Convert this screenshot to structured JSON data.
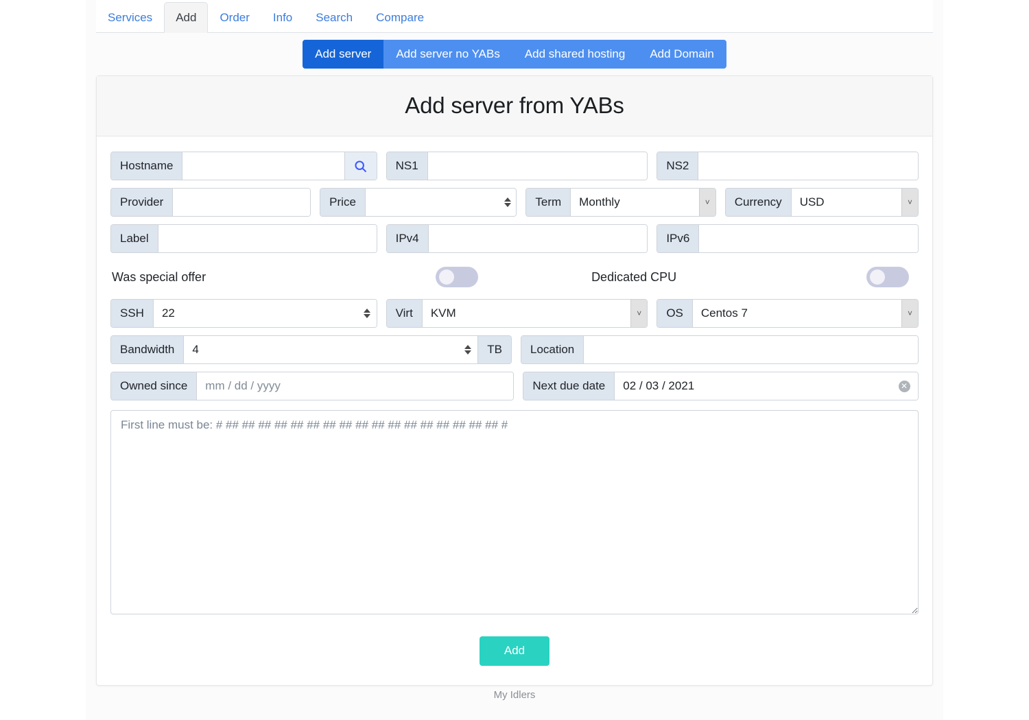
{
  "nav": {
    "tabs": [
      {
        "label": "Services",
        "active": false
      },
      {
        "label": "Add",
        "active": true
      },
      {
        "label": "Order",
        "active": false
      },
      {
        "label": "Info",
        "active": false
      },
      {
        "label": "Search",
        "active": false
      },
      {
        "label": "Compare",
        "active": false
      }
    ]
  },
  "segmented": {
    "buttons": [
      {
        "label": "Add server",
        "active": true
      },
      {
        "label": "Add server no YABs",
        "active": false
      },
      {
        "label": "Add shared hosting",
        "active": false
      },
      {
        "label": "Add Domain",
        "active": false
      }
    ],
    "active_color": "#1565d8",
    "inactive_color": "#4d8ff0"
  },
  "card": {
    "title": "Add server from YABs"
  },
  "form": {
    "hostname": {
      "label": "Hostname",
      "value": "",
      "icon": "search-icon"
    },
    "ns1": {
      "label": "NS1",
      "value": ""
    },
    "ns2": {
      "label": "NS2",
      "value": ""
    },
    "provider": {
      "label": "Provider",
      "value": ""
    },
    "price": {
      "label": "Price",
      "value": ""
    },
    "term": {
      "label": "Term",
      "value": "Monthly"
    },
    "currency": {
      "label": "Currency",
      "value": "USD"
    },
    "label_field": {
      "label": "Label",
      "value": ""
    },
    "ipv4": {
      "label": "IPv4",
      "value": ""
    },
    "ipv6": {
      "label": "IPv6",
      "value": ""
    },
    "special_offer": {
      "label": "Was special offer",
      "state": "off"
    },
    "dedicated_cpu": {
      "label": "Dedicated CPU",
      "state": "off"
    },
    "ssh": {
      "label": "SSH",
      "value": "22"
    },
    "virt": {
      "label": "Virt",
      "value": "KVM"
    },
    "os": {
      "label": "OS",
      "value": "Centos 7"
    },
    "bandwidth": {
      "label": "Bandwidth",
      "value": "4",
      "unit": "TB"
    },
    "location": {
      "label": "Location",
      "value": ""
    },
    "owned_since": {
      "label": "Owned since",
      "value": "",
      "placeholder": "mm / dd / yyyy"
    },
    "next_due_date": {
      "label": "Next due date",
      "value": "02 / 03 / 2021",
      "clear": "✕"
    },
    "yabs": {
      "value": "",
      "placeholder": "First line must be: # ## ## ## ## ## ## ## ## ## ## ## ## ## ## ## ## ## #"
    },
    "submit": {
      "label": "Add",
      "color": "#2ad2c1"
    }
  },
  "footer": {
    "text": "My Idlers"
  }
}
